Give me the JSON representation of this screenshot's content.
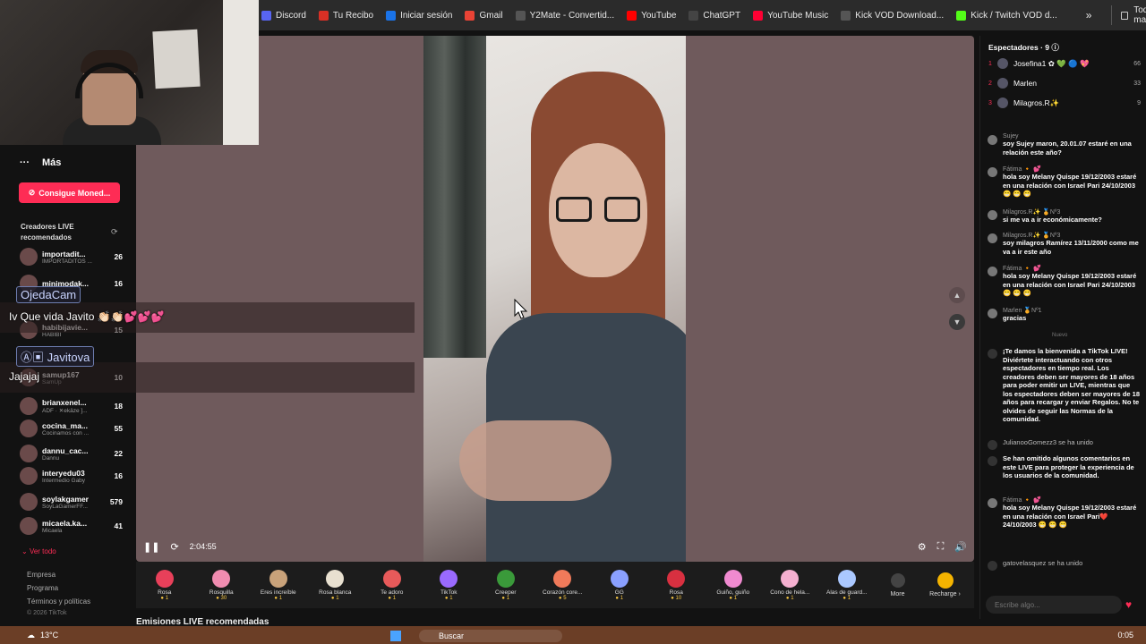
{
  "bookmarks": [
    {
      "label": "Discord",
      "icon": "discord-icon",
      "color": "#5865f2"
    },
    {
      "label": "Tu Recibo",
      "icon": "bookmark-icon",
      "color": "#d93025"
    },
    {
      "label": "Iniciar sesión",
      "icon": "login-icon",
      "color": "#1a73e8"
    },
    {
      "label": "Gmail",
      "icon": "gmail-icon",
      "color": "#ea4335"
    },
    {
      "label": "Y2Mate - Convertid...",
      "icon": "y2mate-icon",
      "color": "#555555"
    },
    {
      "label": "YouTube",
      "icon": "youtube-icon",
      "color": "#ff0000"
    },
    {
      "label": "ChatGPT",
      "icon": "chatgpt-icon",
      "color": "#444444"
    },
    {
      "label": "YouTube Music",
      "icon": "youtube-music-icon",
      "color": "#ff0033"
    },
    {
      "label": "Kick VOD Download...",
      "icon": "kick-icon",
      "color": "#555555"
    },
    {
      "label": "Kick / Twitch VOD d...",
      "icon": "kick-d-icon",
      "color": "#53fc18"
    }
  ],
  "bookmarks_more": "»",
  "bookmarks_all": "Todos los marcadores",
  "sidebar": {
    "mas": "Más",
    "coins_button": "Consigue Moned...",
    "creators_title": "Creadores LIVE recomendados",
    "creators": [
      {
        "name": "importadit...",
        "sub": "IMPORTADITOS ...",
        "count": "26"
      },
      {
        "name": "minimodak...",
        "sub": "",
        "count": "16"
      },
      {
        "name": "",
        "sub": "",
        "count": ""
      },
      {
        "name": "habibijavie...",
        "sub": "HABIBI",
        "count": "15"
      },
      {
        "name": "",
        "sub": "",
        "count": ""
      },
      {
        "name": "samup167",
        "sub": "SamUp",
        "count": "10"
      },
      {
        "name": "brianxenel...",
        "sub": "ADF · ✕ekäze ]...",
        "count": "18"
      },
      {
        "name": "cocina_ma...",
        "sub": "Cocinamos con ...",
        "count": "55"
      },
      {
        "name": "dannu_cac...",
        "sub": "Dannu",
        "count": "22"
      },
      {
        "name": "interyedu03",
        "sub": "Intermedio Gaby",
        "count": "16"
      },
      {
        "name": "soylakgamer",
        "sub": "SoyLaGamerFF...",
        "count": "579"
      },
      {
        "name": "micaela.ka...",
        "sub": "Micaela",
        "count": "41"
      }
    ],
    "ver_todo": "Ver todo",
    "footer": [
      "Empresa",
      "Programa",
      "Términos y políticas"
    ],
    "copyright": "© 2026 TikTok"
  },
  "overlay": {
    "tag1": "OjedaCam",
    "msg1": "Iv Que vida Javito 👏🏻👏🏻💕💕💕",
    "tag2": "Javitova",
    "msg2": "Jajajaj"
  },
  "player": {
    "time": "2:04:55"
  },
  "gifts": [
    {
      "name": "Rosa",
      "price": "1",
      "color": "#e8405a"
    },
    {
      "name": "Rosquilla",
      "price": "30",
      "color": "#f08cb0"
    },
    {
      "name": "Eres increíble",
      "price": "1",
      "color": "#c9a27a"
    },
    {
      "name": "Rosa blanca",
      "price": "1",
      "color": "#e8e0d0"
    },
    {
      "name": "Te adoro",
      "price": "1",
      "color": "#e85a5a"
    },
    {
      "name": "TikTok",
      "price": "1",
      "color": "#9a6aff"
    },
    {
      "name": "Creeper",
      "price": "1",
      "color": "#3a9a3a"
    },
    {
      "name": "Corazón core...",
      "price": "5",
      "color": "#f07a5a"
    },
    {
      "name": "GG",
      "price": "1",
      "color": "#8aa0ff"
    },
    {
      "name": "Rosa",
      "price": "10",
      "color": "#d83040"
    },
    {
      "name": "Guiño, guiño",
      "price": "1",
      "color": "#f08ad0"
    },
    {
      "name": "Cono de hela...",
      "price": "1",
      "color": "#f5b0d0"
    },
    {
      "name": "Alas de guard...",
      "price": "1",
      "color": "#aac8ff"
    }
  ],
  "gift_more": "More",
  "recharge": "Recharge ›",
  "emisiones": "Emisiones LIVE recomendadas",
  "chat": {
    "viewers_title": "Espectadores · 9",
    "viewers": [
      {
        "rank": "1",
        "name": "Josefina1 ✿ 💚 🔵 💖",
        "count": "66"
      },
      {
        "rank": "2",
        "name": "Marlen",
        "count": "33"
      },
      {
        "rank": "3",
        "name": "Milagros.R✨",
        "count": "9"
      }
    ],
    "messages": [
      {
        "name": "Sujey",
        "text": "soy Sujey maron, 20.01.07 estaré en una relación este año?"
      },
      {
        "name": "Fátima 🔸 💕",
        "text": "hola soy Melany Quispe 19/12/2003 estaré en una relación con Israel Pari 24/10/2003 😁 😁 😁"
      },
      {
        "name": "Milagros.R✨ 🏅Nº3",
        "text": "si me va a ir económicamente?"
      },
      {
        "name": "Milagros.R✨ 🏅Nº3",
        "text": "soy milagros Ramírez 13/11/2000 como me va a ir este año"
      },
      {
        "name": "Fátima 🔸 💕",
        "text": "hola soy Melany Quispe 19/12/2003 estaré en una relación con Israel Pari 24/10/2003 😁 😁 😁"
      },
      {
        "name": "Marlen 🏅Nº1",
        "text": "gracias"
      }
    ],
    "new_label": "Nuevo",
    "welcome": "¡Te damos la bienvenida a TikTok LIVE! Diviértete interactuando con otros espectadores en tiempo real. Los creadores deben ser mayores de 18 años para poder emitir un LIVE, mientras que los espectadores deben ser mayores de 18 años para recargar y enviar Regalos. No te olvides de seguir las Normas de la comunidad.",
    "join1_name": "JulianooGomezz3",
    "join_text": "se ha unido",
    "omitted": "Se han omitido algunos comentarios en este LIVE para proteger la experiencia de los usuarios de la comunidad.",
    "last_msg": {
      "name": "Fátima 🔸 💕",
      "text": "hola soy Melany Quispe 19/12/2003 estaré en una relación con Israel Pari❤️ 24/10/2003 😁 😁 😁"
    },
    "join2_name": "gatovelasquez",
    "input_placeholder": "Escribe algo..."
  },
  "taskbar": {
    "temp": "13°C",
    "search": "Buscar",
    "time": "0:05"
  }
}
